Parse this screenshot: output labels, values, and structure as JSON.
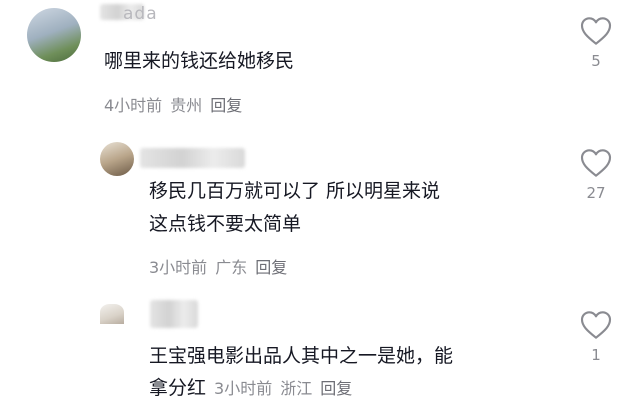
{
  "comments": [
    {
      "username_visible": "ada",
      "text": "哪里来的钱还给她移民",
      "time": "4小时前",
      "location": "贵州",
      "reply_label": "回复",
      "likes": "5",
      "like_icon": "heart-outline-icon"
    },
    {
      "text_line1": "移民几百万就可以了 所以明星来说",
      "text_line2": "这点钱不要太简单",
      "time": "3小时前",
      "location": "广东",
      "reply_label": "回复",
      "likes": "27",
      "like_icon": "heart-outline-icon"
    },
    {
      "text_line1": "王宝强电影出品人其中之一是她，能",
      "text_line2": "拿分红",
      "time": "3小时前",
      "location": "浙江",
      "reply_label": "回复",
      "likes": "1",
      "like_icon": "heart-outline-icon"
    }
  ],
  "colors": {
    "text": "#161823",
    "meta": "#8a8b91",
    "background": "#ffffff",
    "heart_stroke": "#8a8b91"
  }
}
